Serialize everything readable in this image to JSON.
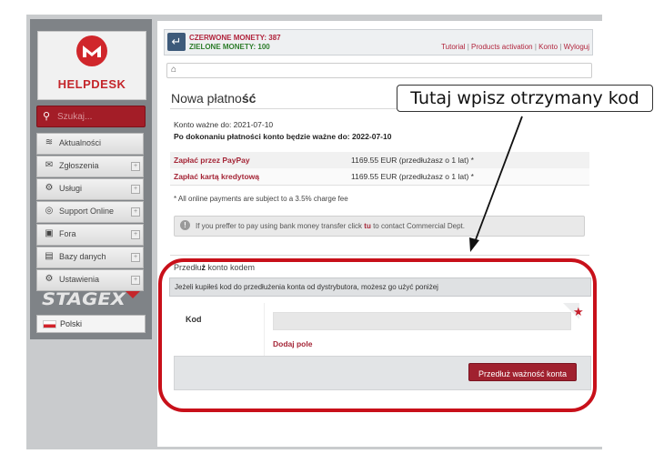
{
  "app": {
    "logo_text": "HELPDESK",
    "brand_color": "#c4262b",
    "stage_logo_text": "STAGEX"
  },
  "search": {
    "placeholder": "Szukaj..."
  },
  "sidebar": {
    "items": [
      {
        "label": "Aktualności",
        "icon": "rss-icon"
      },
      {
        "label": "Zgłoszenia",
        "icon": "envelope-icon"
      },
      {
        "label": "Usługi",
        "icon": "gear-icon"
      },
      {
        "label": "Support Online",
        "icon": "support-icon"
      },
      {
        "label": "Fora",
        "icon": "chat-icon"
      },
      {
        "label": "Bazy danych",
        "icon": "folder-icon"
      },
      {
        "label": "Ustawienia",
        "icon": "settings-icon"
      }
    ],
    "language": "Polski"
  },
  "header": {
    "red_coins": "CZERWONE MONETY: 387",
    "green_coins": "ZIELONE MONETY: 100",
    "links": [
      "Tutorial",
      "Products activation",
      "Konto",
      "Wyloguj"
    ]
  },
  "page": {
    "title_prefix": "Nowa płatno",
    "title_bold": "ść",
    "valid_now": "Konto ważne do: 2021-07-10",
    "valid_after": "Po dokonaniu płatności konto będzie ważne do: 2022-07-10",
    "payments": [
      {
        "label": "Zapłać przez PayPay",
        "price": "1169.55 EUR (przedłużasz o 1 lat) *"
      },
      {
        "label": "Zapłać kartą kredytową",
        "price": "1169.55 EUR (przedłużasz o 1 lat) *"
      }
    ],
    "note": "* All online payments are subject to a 3.5% charge fee",
    "info_before": "If you preffer to pay using bank money transfer click ",
    "info_link": "tu",
    "info_after": " to contact Commercial Dept."
  },
  "code_section": {
    "title_prefix": "Przedłu",
    "title_bold": "ż",
    "title_suffix": " konto kodem",
    "description": "Jeżeli kupiłeś kod do przedłużenia konta od dystrybutora, możesz go użyć poniżej",
    "label": "Kod",
    "input_value": "",
    "add_field": "Dodaj pole",
    "submit": "Przedłuż ważność konta"
  },
  "annotation": {
    "text": "Tutaj wpisz otrzymany kod",
    "color": "#c8101a"
  }
}
